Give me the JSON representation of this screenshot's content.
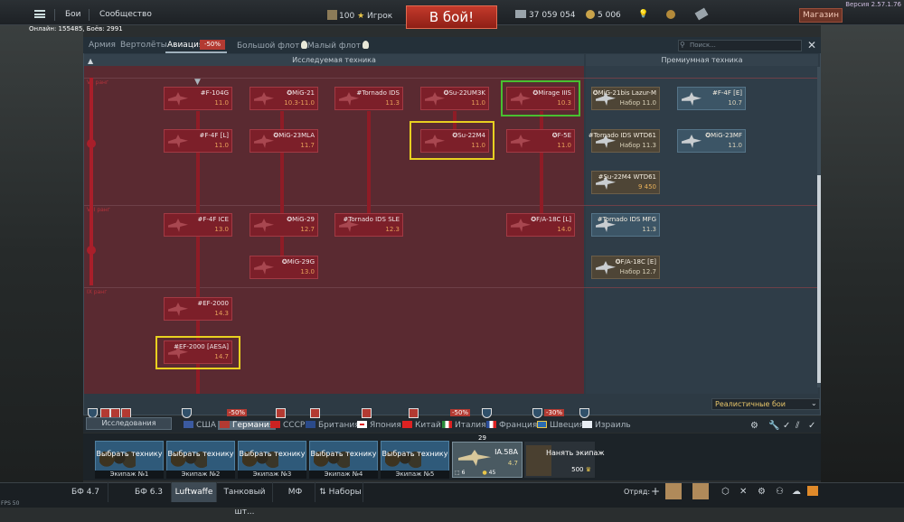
{
  "app": {
    "version": "Версия 2.57.1.76",
    "online": "Онлайн: 155485, Боёв: 2991",
    "fps": "FPS 50"
  },
  "topbar": {
    "nav_battles": "Бои",
    "nav_community": "Сообщество",
    "player_level": "100",
    "player_name": "Игрок",
    "battle_button": "В бой!",
    "silver": "37 059 054",
    "gold": "5 006",
    "shop": "Магазин"
  },
  "tabs": [
    {
      "label": "Армия"
    },
    {
      "label": "Вертолёты"
    },
    {
      "label": "Авиация",
      "active": true,
      "sale": "-50%"
    },
    {
      "label": "Большой флот"
    },
    {
      "label": "Малый флот"
    }
  ],
  "search_placeholder": "Поиск...",
  "headers": {
    "research": "Исследуемая техника",
    "premium": "Премиумная техника"
  },
  "ranks": [
    "VII ранг",
    "VIII ранг",
    "IX ранг"
  ],
  "tree": [
    {
      "name": "#F-104G",
      "br": "11.0"
    },
    {
      "name": "✪MiG-21",
      "br": "10.3-11.0"
    },
    {
      "name": "#Tornado IDS",
      "br": "11.3"
    },
    {
      "name": "✪Su-22UM3K",
      "br": "11.0"
    },
    {
      "name": "✪Mirage IIIS",
      "br": "10.3"
    },
    {
      "name": "#F-4F [L]",
      "br": "11.0"
    },
    {
      "name": "✪MiG-23MLA",
      "br": "11.7"
    },
    {
      "name": "✪Su-22M4",
      "br": "11.0"
    },
    {
      "name": "✪F-5E",
      "br": "11.0"
    },
    {
      "name": "#F-4F ICE",
      "br": "13.0"
    },
    {
      "name": "✪MiG-29",
      "br": "12.7"
    },
    {
      "name": "#Tornado IDS SLE",
      "br": "12.3"
    },
    {
      "name": "✪F/A-18C [L]",
      "br": "14.0"
    },
    {
      "name": "✪MiG-29G",
      "br": "13.0"
    },
    {
      "name": "#EF-2000",
      "br": "14.3"
    },
    {
      "name": "#EF-2000 [AESA]",
      "br": "14.7"
    }
  ],
  "premium": [
    {
      "name": "✪MiG-21bis Lazur-M",
      "br": "Набор 11.0"
    },
    {
      "name": "#F-4F [E]",
      "br": "10.7"
    },
    {
      "name": "#Tornado IDS WTD61",
      "br": "Набор 11.3"
    },
    {
      "name": "✪MiG-23MF",
      "br": "11.0"
    },
    {
      "name": "#Su-22M4 WTD61",
      "br": "9 450"
    },
    {
      "name": "#Tornado IDS MFG",
      "br": "11.3"
    },
    {
      "name": "✪F/A-18C [E]",
      "br": "Набор 12.7"
    }
  ],
  "mode": "Реалистичные бои",
  "research_tab": "Исследования",
  "discounts": [
    "-50%",
    "-50%",
    "-30%"
  ],
  "countries": [
    {
      "label": "США",
      "color": "#3b5aa0"
    },
    {
      "label": "Германия",
      "active": true,
      "color": "#b33a32"
    },
    {
      "label": "СССР",
      "color": "#c22"
    },
    {
      "label": "Британия",
      "color": "#2a4a8a"
    },
    {
      "label": "Япония",
      "color": "#fff"
    },
    {
      "label": "Китай",
      "color": "#d22"
    },
    {
      "label": "Италия",
      "color": "#2a8a3a"
    },
    {
      "label": "Франция",
      "color": "#2b4d9b"
    },
    {
      "label": "Швеция",
      "color": "#2b6cb0"
    },
    {
      "label": "Израиль",
      "color": "#e8eef4"
    }
  ],
  "crew": {
    "select_label": "Выбрать технику",
    "crews": [
      "Экипаж №1",
      "Экипаж №2",
      "Экипаж №3",
      "Экипаж №4",
      "Экипаж №5"
    ],
    "vehicle_name": "IA.58A",
    "vehicle_br": "4.7",
    "vehicle_count": "29",
    "vehicle_footer_left": "6",
    "vehicle_footer_right": "45",
    "hire_label": "Нанять экипаж",
    "hire_cost": "500"
  },
  "bottom_tabs": [
    "БФ 4.7",
    "БФ 6.3",
    "Luftwaffe",
    "Танковый шт...",
    "МФ",
    "Наборы"
  ],
  "squad_label": "Отряд:"
}
